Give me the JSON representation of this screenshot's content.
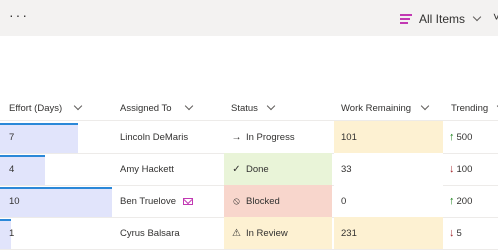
{
  "toolbar": {
    "more_label": "···",
    "view_label": "All Items"
  },
  "columns": [
    {
      "label": "Effort (Days)"
    },
    {
      "label": "Assigned To"
    },
    {
      "label": "Status"
    },
    {
      "label": "Work Remaining"
    },
    {
      "label": "Trending"
    }
  ],
  "effort_max": 10,
  "rows": [
    {
      "effort": "7",
      "assigned": "Lincoln DeMaris",
      "mail": false,
      "status": "In Progress",
      "status_icon": "arrow-right-icon",
      "status_bg": "#ffffff",
      "remaining": "101",
      "remaining_bg": "#fdf1d2",
      "trend_dir": "up",
      "trend": "500"
    },
    {
      "effort": "4",
      "assigned": "Amy Hackett",
      "mail": false,
      "status": "Done",
      "status_icon": "check-icon",
      "status_bg": "#e9f4d8",
      "remaining": "33",
      "remaining_bg": "#ffffff",
      "trend_dir": "down",
      "trend": "100"
    },
    {
      "effort": "10",
      "assigned": "Ben Truelove",
      "mail": true,
      "status": "Blocked",
      "status_icon": "blocked-icon",
      "status_bg": "#f8d6cc",
      "remaining": "0",
      "remaining_bg": "#ffffff",
      "trend_dir": "up",
      "trend": "200"
    },
    {
      "effort": "1",
      "assigned": "Cyrus Balsara",
      "mail": false,
      "status": "In Review",
      "status_icon": "warning-icon",
      "status_bg": "#fdf1d2",
      "remaining": "231",
      "remaining_bg": "#fdf1d2",
      "trend_dir": "down",
      "trend": "5"
    }
  ],
  "colors": {
    "accent": "#c239b3",
    "up": "#107c10",
    "down": "#a4262c",
    "bar": "#e1e4fb",
    "bar_top": "#2b88d8"
  }
}
